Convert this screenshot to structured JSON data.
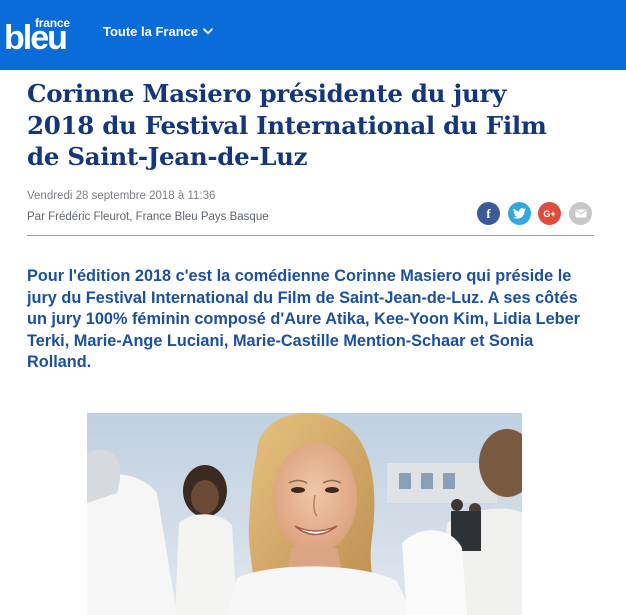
{
  "header": {
    "logo_top": "france",
    "logo_main": "bleu",
    "region_label": "Toute la France",
    "brand_color": "#0a6cd8"
  },
  "article": {
    "title": "Corinne Masiero présidente du jury 2018 du Festival International du Film de Saint-Jean-de-Luz",
    "date": "Vendredi 28 septembre 2018 à 11:36",
    "author_prefix": "Par ",
    "author_name": "Frédéric Fleurot",
    "author_sep": ", ",
    "author_station": "France Bleu Pays Basque",
    "chapo": "Pour l'édition 2018 c'est la comédienne Corinne Masiero qui préside le jury du Festival International du Film de Saint-Jean-de-Luz. A ses côtés un jury 100% féminin composé d'Aure Atika, Kee-Yoon Kim, Lidia Leber Terki, Marie-Ange Luciani, Marie-Castille Mention-Schaar et Sonia Rolland."
  },
  "share": {
    "facebook_glyph": "f",
    "googleplus_glyph": "G+",
    "icons": [
      "facebook-icon",
      "twitter-icon",
      "google-plus-icon",
      "mail-icon"
    ]
  },
  "colors": {
    "title": "#14367a",
    "chapo": "#1c4f9c",
    "facebook": "#3b5a99",
    "twitter": "#35a6e0",
    "googleplus": "#dd4c3c",
    "mail": "#c8c8c8"
  }
}
